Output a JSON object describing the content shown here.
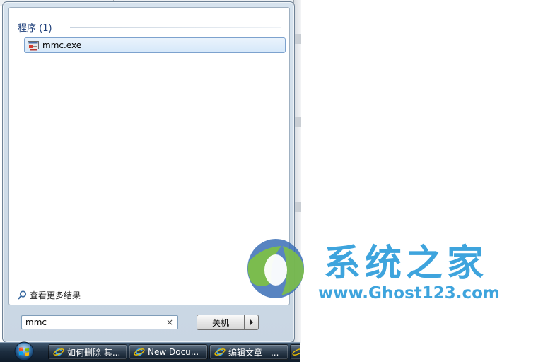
{
  "start_menu": {
    "section_header": "程序 (1)",
    "results": [
      {
        "label": "mmc.exe",
        "icon": "mmc-console-icon"
      }
    ],
    "see_more_label": "查看更多结果",
    "search": {
      "value": "mmc",
      "clear_glyph": "×"
    },
    "shutdown_label": "关机"
  },
  "taskbar": {
    "buttons": [
      {
        "label": "如何删除 其...",
        "icon": "ie-icon"
      },
      {
        "label": "New Docu...",
        "icon": "ie-icon"
      },
      {
        "label": "编辑文章 - ...",
        "icon": "ie-icon"
      }
    ]
  },
  "watermark": {
    "title": "系统之家",
    "url": "www.Ghost123.com"
  },
  "colors": {
    "accent": "#3ea4dd",
    "selection_border": "#7da2ce",
    "header_text": "#1e3f7a"
  }
}
